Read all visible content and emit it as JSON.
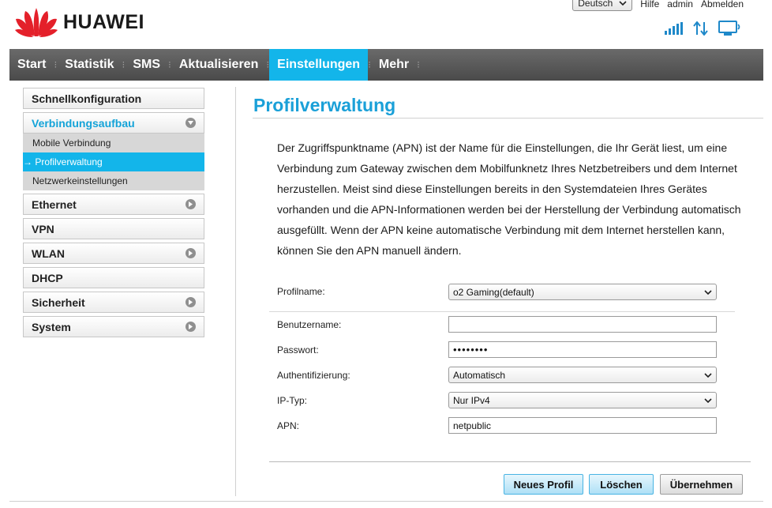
{
  "header": {
    "brand": "HUAWEI",
    "language": "Deutsch",
    "links": {
      "help": "Hilfe",
      "user": "admin",
      "logout": "Abmelden"
    }
  },
  "status_icons": [
    "signal-strength-icon",
    "data-transfer-icon",
    "computer-connected-icon"
  ],
  "nav": {
    "items": [
      "Start",
      "Statistik",
      "SMS",
      "Aktualisieren",
      "Einstellungen",
      "Mehr"
    ],
    "active": "Einstellungen"
  },
  "sidebar": {
    "quick_setup": "Schnellkonfiguration",
    "connection": {
      "label": "Verbindungsaufbau",
      "sub": [
        "Mobile Verbindung",
        "→ Profilverwaltung",
        "Netzwerkeinstellungen"
      ]
    },
    "items": [
      "Ethernet",
      "VPN",
      "WLAN",
      "DHCP",
      "Sicherheit",
      "System"
    ]
  },
  "main": {
    "title": "Profilverwaltung",
    "description": "Der Zugriffspunktname (APN) ist der Name für die Einstellungen, die Ihr Gerät liest, um eine Verbindung zum Gateway zwischen dem Mobilfunknetz Ihres Netzbetreibers und dem Internet herzustellen. Meist sind diese Einstellungen bereits in den Systemdateien Ihres Gerätes vorhanden und die APN-Informationen werden bei der Herstellung der Verbindung automatisch ausgefüllt. Wenn der APN keine automatische Verbindung mit dem Internet herstellen kann, können Sie den APN manuell ändern.",
    "form": {
      "profile_label": "Profilname:",
      "profile_value": "o2 Gaming(default)",
      "username_label": "Benutzername:",
      "username_value": "",
      "password_label": "Passwort:",
      "password_value": "••••••••",
      "auth_label": "Authentifizierung:",
      "auth_value": "Automatisch",
      "iptype_label": "IP-Typ:",
      "iptype_value": "Nur IPv4",
      "apn_label": "APN:",
      "apn_value": "netpublic"
    },
    "buttons": {
      "new_profile": "Neues Profil",
      "delete": "Löschen",
      "apply": "Übernehmen"
    }
  },
  "colors": {
    "accent": "#13b5ea",
    "title": "#1aa0d8",
    "nav_bg": "#555555"
  }
}
